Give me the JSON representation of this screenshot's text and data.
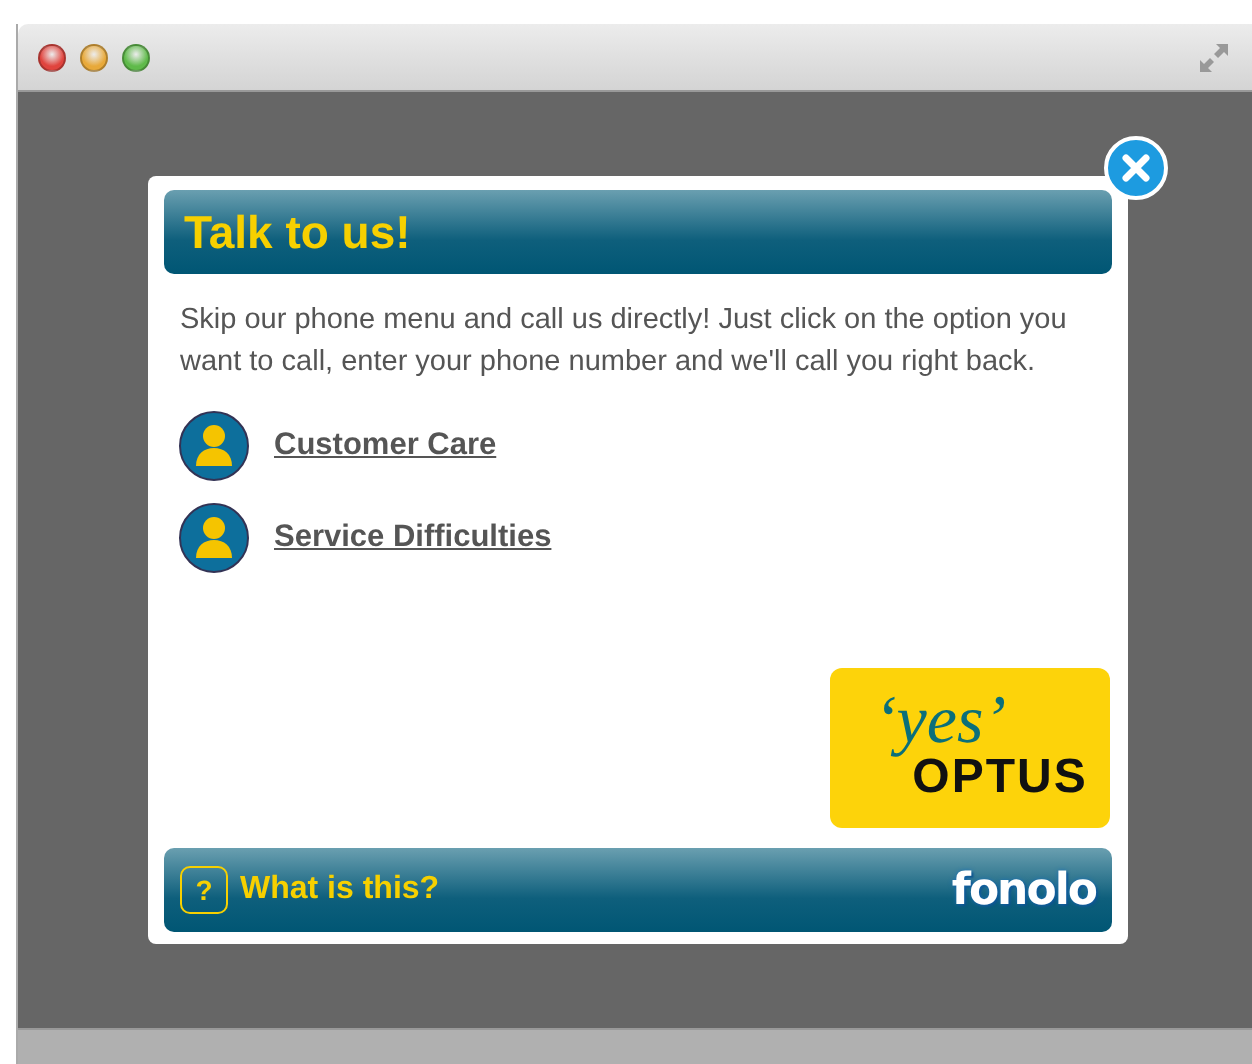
{
  "dialog": {
    "title": "Talk to us!",
    "intro": "Skip our phone menu and call us directly! Just click on the option you want to call, enter your phone number and we'll call you right back.",
    "options": [
      {
        "label": "Customer Care"
      },
      {
        "label": "Service Difficulties"
      }
    ],
    "brand": {
      "line_1": "‘yes’",
      "line_2": "OPTUS"
    },
    "footer": {
      "help_icon": "?",
      "help_label": "What is this?",
      "logo": "fonolo"
    }
  }
}
